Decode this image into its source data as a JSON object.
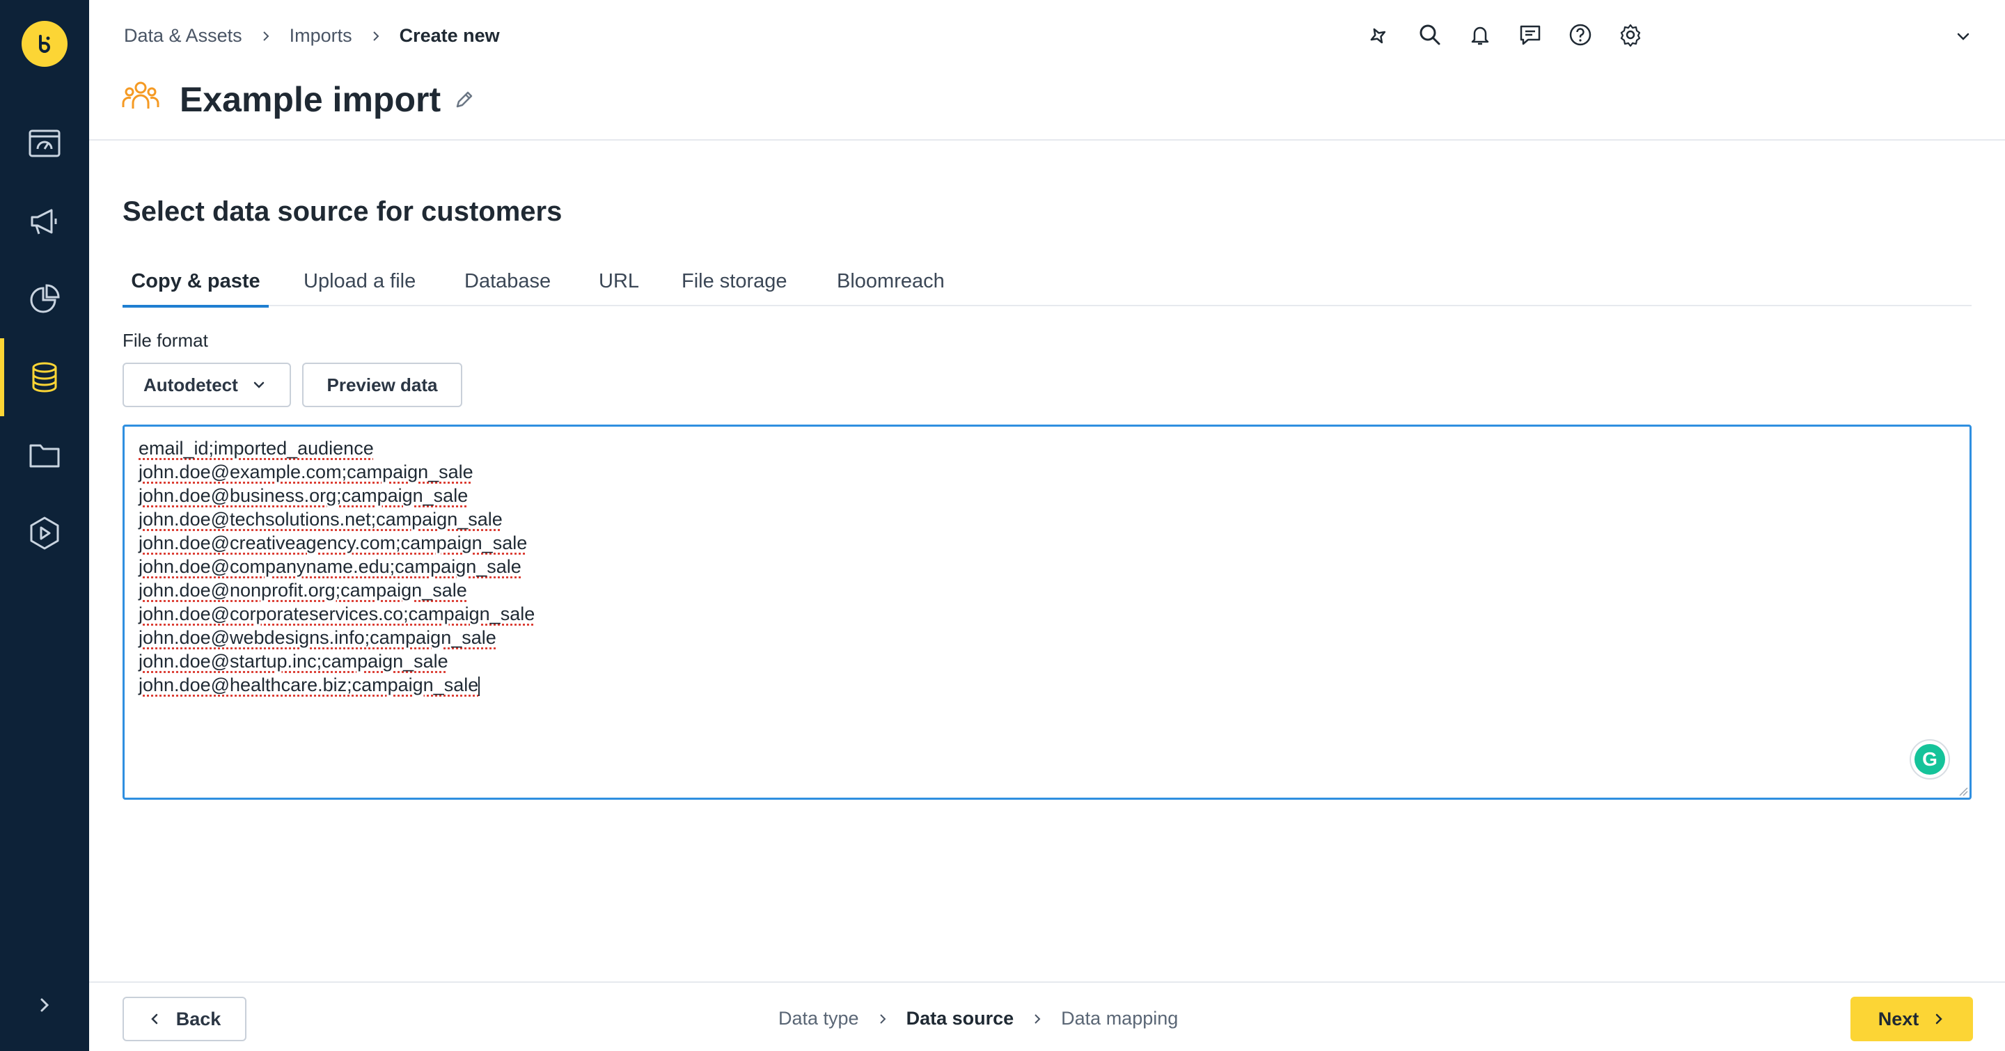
{
  "colors": {
    "sidebar_bg": "#0d2238",
    "accent_yellow": "#fcd535",
    "active_tab_underline": "#1f7fd1",
    "textarea_border": "#2f8fe0"
  },
  "sidebar": {
    "logo_icon": "bloomreach-logo-icon",
    "items": [
      {
        "icon": "dashboard-icon",
        "active": false
      },
      {
        "icon": "megaphone-icon",
        "active": false
      },
      {
        "icon": "pie-chart-icon",
        "active": false
      },
      {
        "icon": "database-icon",
        "active": true
      },
      {
        "icon": "folder-icon",
        "active": false
      },
      {
        "icon": "play-shield-icon",
        "active": false
      }
    ],
    "expand_icon": "chevron-right-icon"
  },
  "header": {
    "breadcrumb": [
      "Data & Assets",
      "Imports",
      "Create new"
    ],
    "title": "Example import",
    "title_icon": "customers-group-icon",
    "edit_icon": "pencil-icon",
    "top_icons": [
      "sparkle-icon",
      "search-icon",
      "bell-icon",
      "chat-icon",
      "help-icon",
      "gear-icon"
    ],
    "account_menu_icon": "chevron-down-icon"
  },
  "main": {
    "section_title": "Select data source for customers",
    "tabs": [
      {
        "label": "Copy & paste",
        "active": true
      },
      {
        "label": "Upload a file",
        "active": false
      },
      {
        "label": "Database",
        "active": false
      },
      {
        "label": "URL",
        "active": false
      },
      {
        "label": "File storage",
        "active": false
      },
      {
        "label": "Bloomreach",
        "active": false
      }
    ],
    "file_format_label": "File format",
    "file_format_value": "Autodetect",
    "preview_button": "Preview data",
    "textarea_lines": [
      "email_id;imported_audience",
      "john.doe@example.com;campaign_sale",
      "john.doe@business.org;campaign_sale",
      "john.doe@techsolutions.net;campaign_sale",
      "john.doe@creativeagency.com;campaign_sale",
      "john.doe@companyname.edu;campaign_sale",
      "john.doe@nonprofit.org;campaign_sale",
      "john.doe@corporateservices.co;campaign_sale",
      "john.doe@webdesigns.info;campaign_sale",
      "john.doe@startup.inc;campaign_sale",
      "john.doe@healthcare.biz;campaign_sale"
    ],
    "grammarly_icon": "grammarly-icon"
  },
  "footer": {
    "back_label": "Back",
    "steps": [
      "Data type",
      "Data source",
      "Data mapping"
    ],
    "current_step": "Data source",
    "next_label": "Next"
  }
}
